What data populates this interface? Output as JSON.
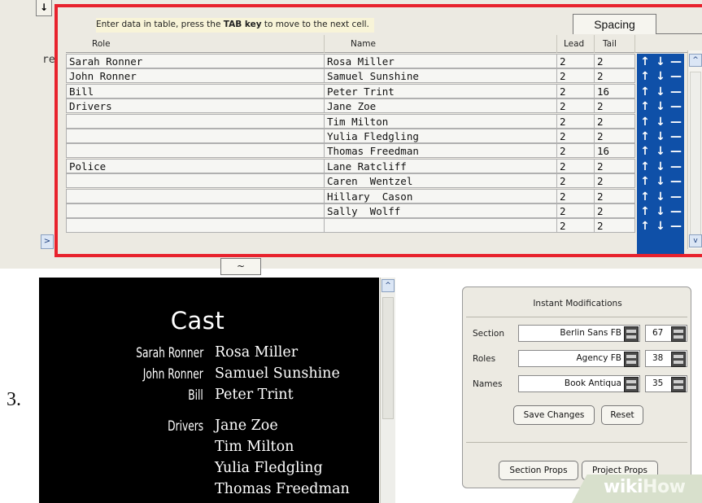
{
  "corner_button": "↓",
  "side_label": "re",
  "side_arrow": ">",
  "instruction": {
    "prefix": "Enter data in table, press the ",
    "key": "TAB key",
    "suffix": " to move to the next cell."
  },
  "spacing_tab": "Spacing",
  "columns": {
    "role": "Role",
    "name": "Name",
    "lead": "Lead",
    "tail": "Tail"
  },
  "rows": [
    {
      "role": "Sarah Ronner",
      "name": "Rosa Miller",
      "lead": "2",
      "tail": "2"
    },
    {
      "role": "John Ronner",
      "name": "Samuel Sunshine",
      "lead": "2",
      "tail": "2"
    },
    {
      "role": "Bill",
      "name": "Peter Trint",
      "lead": "2",
      "tail": "16"
    },
    {
      "role": "Drivers",
      "name": "Jane Zoe",
      "lead": "2",
      "tail": "2"
    },
    {
      "role": "",
      "name": "Tim Milton",
      "lead": "2",
      "tail": "2"
    },
    {
      "role": "",
      "name": "Yulia Fledgling",
      "lead": "2",
      "tail": "2"
    },
    {
      "role": "",
      "name": "Thomas Freedman",
      "lead": "2",
      "tail": "16"
    },
    {
      "role": "Police",
      "name": "Lane Ratcliff",
      "lead": "2",
      "tail": "2"
    },
    {
      "role": "",
      "name": "Caren  Wentzel",
      "lead": "2",
      "tail": "2"
    },
    {
      "role": "",
      "name": "Hillary  Cason",
      "lead": "2",
      "tail": "2"
    },
    {
      "role": "",
      "name": "Sally  Wolff",
      "lead": "2",
      "tail": "2"
    },
    {
      "role": "",
      "name": "",
      "lead": "2",
      "tail": "2"
    }
  ],
  "row_arrows": {
    "up": "↑",
    "down": "↓",
    "remove": "—"
  },
  "scroll": {
    "up": "^",
    "down": "v"
  },
  "tilde_button": "~",
  "step_number": "3.",
  "preview": {
    "title": "Cast",
    "entries": [
      {
        "role": "Sarah Ronner",
        "name": "Rosa Miller"
      },
      {
        "role": "John Ronner",
        "name": "Samuel Sunshine"
      },
      {
        "role": "Bill",
        "name": "Peter Trint"
      },
      {
        "role": "Drivers",
        "name": "Jane Zoe"
      },
      {
        "role": "",
        "name": "Tim Milton"
      },
      {
        "role": "",
        "name": "Yulia Fledgling"
      },
      {
        "role": "",
        "name": "Thomas Freedman"
      }
    ]
  },
  "panel": {
    "title": "Instant Modifications",
    "section": {
      "label": "Section",
      "font": "Berlin Sans FB",
      "size": "67"
    },
    "roles": {
      "label": "Roles",
      "font": "Agency FB",
      "size": "38"
    },
    "names": {
      "label": "Names",
      "font": "Book Antiqua",
      "size": "35"
    },
    "save_button": "Save Changes",
    "reset_button": "Reset",
    "section_props_button": "Section Props",
    "project_props_button": "Project Props"
  },
  "watermark": {
    "bold": "wiki",
    "light": "How"
  }
}
